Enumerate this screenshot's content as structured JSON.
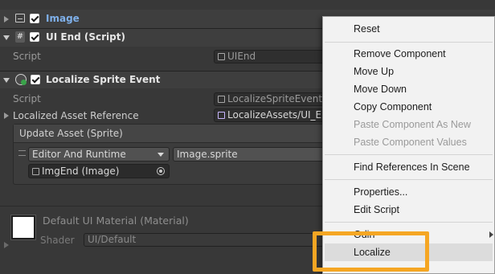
{
  "components": {
    "image": {
      "title": "Image",
      "enabled": true
    },
    "ui_end": {
      "title": "UI End (Script)",
      "script_label": "Script",
      "script_value": "UIEnd"
    },
    "localize_sprite_event": {
      "title": "Localize Sprite Event",
      "script_label": "Script",
      "script_value": "LocalizeSpriteEvent",
      "asset_ref_label": "Localized Asset Reference",
      "asset_ref_value": "LocalizeAssets/UI_E",
      "update_asset_header": "Update Asset (Sprite)",
      "runtime_option": "Editor And Runtime",
      "method_value": "Image.sprite",
      "target_object": "ImgEnd (Image)"
    },
    "material": {
      "title": "Default UI Material (Material)",
      "shader_label": "Shader",
      "shader_value": "UI/Default"
    }
  },
  "context_menu": {
    "items": [
      {
        "label": "Reset",
        "enabled": true
      },
      {
        "label": "Remove Component",
        "enabled": true
      },
      {
        "label": "Move Up",
        "enabled": true
      },
      {
        "label": "Move Down",
        "enabled": true
      },
      {
        "label": "Copy Component",
        "enabled": true
      },
      {
        "label": "Paste Component As New",
        "enabled": false
      },
      {
        "label": "Paste Component Values",
        "enabled": false
      },
      {
        "label": "Find References In Scene",
        "enabled": true
      },
      {
        "label": "Properties...",
        "enabled": true
      },
      {
        "label": "Edit Script",
        "enabled": true
      },
      {
        "label": "Odin",
        "enabled": true,
        "has_submenu": true
      },
      {
        "label": "Localize",
        "enabled": true,
        "highlighted": true
      }
    ]
  },
  "colors": {
    "inspector_bg": "#383838",
    "menu_bg": "#f2f2f2",
    "highlight_outline": "#f5a623",
    "title_link": "#7fb0ea"
  }
}
